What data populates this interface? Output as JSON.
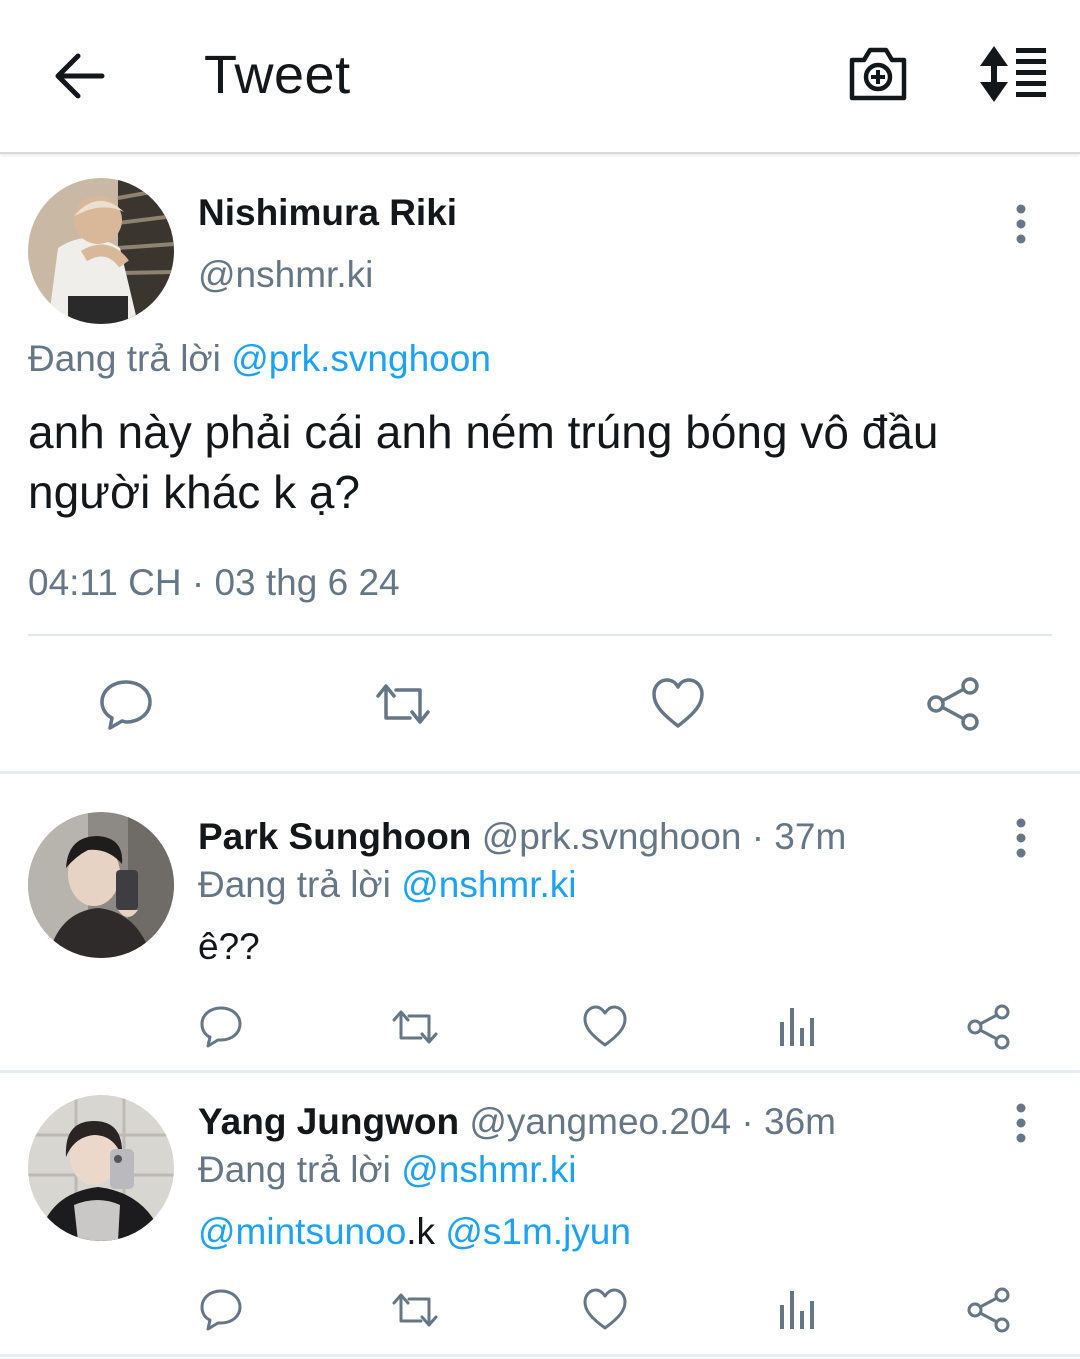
{
  "header": {
    "title": "Tweet",
    "back_icon": "arrow-left-icon",
    "camera_icon": "camera-plus-icon",
    "sort_icon": "sort-list-icon"
  },
  "main_tweet": {
    "author_name": "Nishimura Riki",
    "author_handle": "@nshmr.ki",
    "replying_prefix": "Đang trả lời",
    "replying_to": "@prk.svnghoon",
    "text": "anh này phải cái anh ném trúng bóng vô đầu người khác k ạ?",
    "timestamp": "04:11 CH · 03 thg 6 24"
  },
  "replies": [
    {
      "author_name": "Park Sunghoon",
      "author_handle": "@prk.svnghoon",
      "time": "· 37m",
      "replying_prefix": "Đang trả lời",
      "replying_to": "@nshmr.ki",
      "text": "ê??"
    },
    {
      "author_name": "Yang Jungwon",
      "author_handle": "@yangmeo.204",
      "time": "· 36m",
      "replying_prefix": "Đang trả lời",
      "replying_to": "@nshmr.ki",
      "text_parts": [
        "@mintsunoo",
        ".k ",
        "@s1m.jyun"
      ]
    }
  ],
  "colors": {
    "accent": "#1da1f2",
    "secondary_text": "#657786",
    "icon": "#657786",
    "text": "#14171a"
  }
}
